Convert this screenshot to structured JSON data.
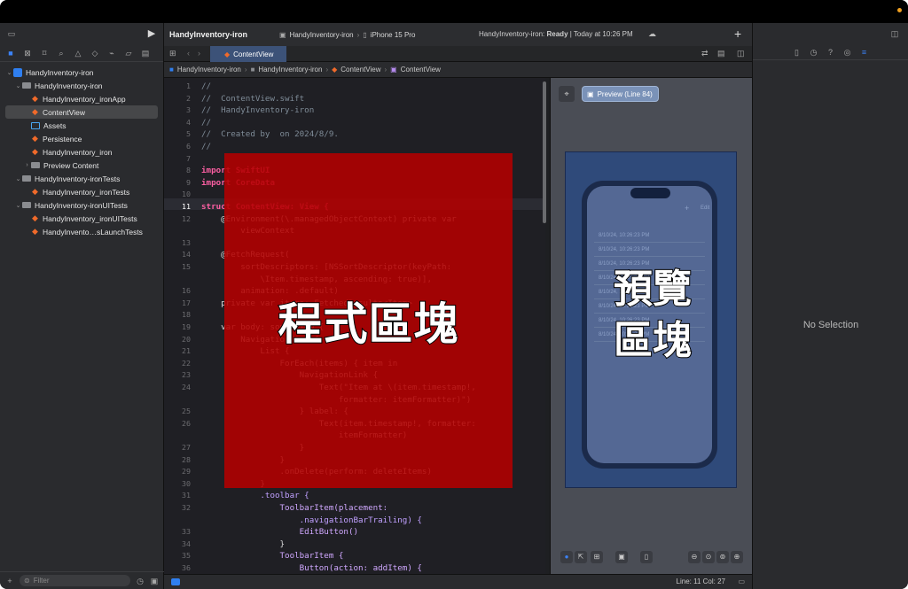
{
  "project": {
    "name": "HandyInventory-iron"
  },
  "toolbar": {
    "scheme": "HandyInventory-iron",
    "device": "iPhone 15 Pro",
    "status_prefix": "HandyInventory-iron:",
    "status_state": "Ready",
    "status_time": "Today at 10:26 PM",
    "add_label": "+"
  },
  "navigator": {
    "items": [
      {
        "label": "HandyInventory-iron",
        "kind": "project",
        "indent": 0,
        "chevron": "⌄"
      },
      {
        "label": "HandyInventory-iron",
        "kind": "folder",
        "indent": 1,
        "chevron": "⌄"
      },
      {
        "label": "HandyInventory_ironApp",
        "kind": "swift",
        "indent": 2,
        "chevron": ""
      },
      {
        "label": "ContentView",
        "kind": "swift",
        "indent": 2,
        "chevron": "",
        "selected": true
      },
      {
        "label": "Assets",
        "kind": "assets",
        "indent": 2,
        "chevron": ""
      },
      {
        "label": "Persistence",
        "kind": "swift",
        "indent": 2,
        "chevron": ""
      },
      {
        "label": "HandyInventory_iron",
        "kind": "swift",
        "indent": 2,
        "chevron": ""
      },
      {
        "label": "Preview Content",
        "kind": "folder",
        "indent": 2,
        "chevron": "›"
      },
      {
        "label": "HandyInventory-ironTests",
        "kind": "folder",
        "indent": 1,
        "chevron": "⌄"
      },
      {
        "label": "HandyInventory_ironTests",
        "kind": "swift",
        "indent": 2,
        "chevron": ""
      },
      {
        "label": "HandyInventory-ironUITests",
        "kind": "folder",
        "indent": 1,
        "chevron": "⌄"
      },
      {
        "label": "HandyInventory_ironUITests",
        "kind": "swift",
        "indent": 2,
        "chevron": ""
      },
      {
        "label": "HandyInvento…sLaunchTests",
        "kind": "swift",
        "indent": 2,
        "chevron": ""
      }
    ],
    "filter_placeholder": "Filter"
  },
  "tabs": {
    "active": "ContentView"
  },
  "jumpbar": [
    "HandyInventory-iron",
    "HandyInventory-iron",
    "ContentView",
    "ContentView"
  ],
  "code": [
    {
      "n": "1",
      "t": "//",
      "c": "cmt"
    },
    {
      "n": "2",
      "t": "//  ContentView.swift",
      "c": "cmt"
    },
    {
      "n": "3",
      "t": "//  HandyInventory-iron",
      "c": "cmt"
    },
    {
      "n": "4",
      "t": "//",
      "c": "cmt"
    },
    {
      "n": "5",
      "t": "//  Created by  on 2024/8/9.",
      "c": "cmt"
    },
    {
      "n": "6",
      "t": "//",
      "c": "cmt"
    },
    {
      "n": "7",
      "t": "",
      "c": ""
    },
    {
      "n": "8",
      "t": "import SwiftUI",
      "c": "kw"
    },
    {
      "n": "9",
      "t": "import CoreData",
      "c": "kw"
    },
    {
      "n": "10",
      "t": "",
      "c": ""
    },
    {
      "n": "11",
      "t": "struct ContentView: View {",
      "c": "kw"
    },
    {
      "n": "12",
      "t": "    @Environment(\\.managedObjectContext) private var",
      "c": ""
    },
    {
      "n": "",
      "t": "        viewContext",
      "c": ""
    },
    {
      "n": "13",
      "t": "",
      "c": ""
    },
    {
      "n": "14",
      "t": "    @FetchRequest(",
      "c": ""
    },
    {
      "n": "15",
      "t": "        sortDescriptors: [NSSortDescriptor(keyPath:",
      "c": ""
    },
    {
      "n": "",
      "t": "            \\Item.timestamp, ascending: true)],",
      "c": ""
    },
    {
      "n": "16",
      "t": "        animation: .default)",
      "c": ""
    },
    {
      "n": "17",
      "t": "    private var items: FetchedResults<Item>",
      "c": ""
    },
    {
      "n": "18",
      "t": "",
      "c": ""
    },
    {
      "n": "19",
      "t": "    var body: some View {",
      "c": ""
    },
    {
      "n": "20",
      "t": "        NavigationView {",
      "c": ""
    },
    {
      "n": "21",
      "t": "            List {",
      "c": ""
    },
    {
      "n": "22",
      "t": "                ForEach(items) { item in",
      "c": ""
    },
    {
      "n": "23",
      "t": "                    NavigationLink {",
      "c": ""
    },
    {
      "n": "24",
      "t": "                        Text(\"Item at \\(item.timestamp!,",
      "c": ""
    },
    {
      "n": "",
      "t": "                            formatter: itemFormatter)\")",
      "c": ""
    },
    {
      "n": "25",
      "t": "                    } label: {",
      "c": ""
    },
    {
      "n": "26",
      "t": "                        Text(item.timestamp!, formatter:",
      "c": ""
    },
    {
      "n": "",
      "t": "                            itemFormatter)",
      "c": ""
    },
    {
      "n": "27",
      "t": "                    }",
      "c": ""
    },
    {
      "n": "28",
      "t": "                }",
      "c": ""
    },
    {
      "n": "29",
      "t": "                .onDelete(perform: deleteItems)",
      "c": ""
    },
    {
      "n": "30",
      "t": "            }",
      "c": ""
    },
    {
      "n": "31",
      "t": "            .toolbar {",
      "c": "pr"
    },
    {
      "n": "32",
      "t": "                ToolbarItem(placement:",
      "c": "ty"
    },
    {
      "n": "",
      "t": "                    .navigationBarTrailing) {",
      "c": "pr"
    },
    {
      "n": "33",
      "t": "                    EditButton()",
      "c": "ty"
    },
    {
      "n": "34",
      "t": "                }",
      "c": ""
    },
    {
      "n": "35",
      "t": "                ToolbarItem {",
      "c": "ty"
    },
    {
      "n": "36",
      "t": "                    Button(action: addItem) {",
      "c": "ty"
    }
  ],
  "overlays": {
    "code_label": "程式區塊",
    "preview_label_1": "預覽",
    "preview_label_2": "區塊"
  },
  "canvas": {
    "preview_button": "Preview (Line 84)",
    "rows": [
      "8/10/24, 10:26:23 PM",
      "8/10/24, 10:26:23 PM",
      "8/10/24, 10:26:23 PM",
      "8/10/24, 10:26:23 PM",
      "8/10/24, 10:26:23 PM",
      "8/10/24, 10:26:23 PM",
      "8/10/24, 10:26:23 PM",
      "8/10/24, 10:26:23 PM"
    ],
    "edit_label": "Edit",
    "plus_label": "+"
  },
  "inspector": {
    "empty_label": "No Selection"
  },
  "statusbar": {
    "position": "Line: 11  Col: 27"
  }
}
